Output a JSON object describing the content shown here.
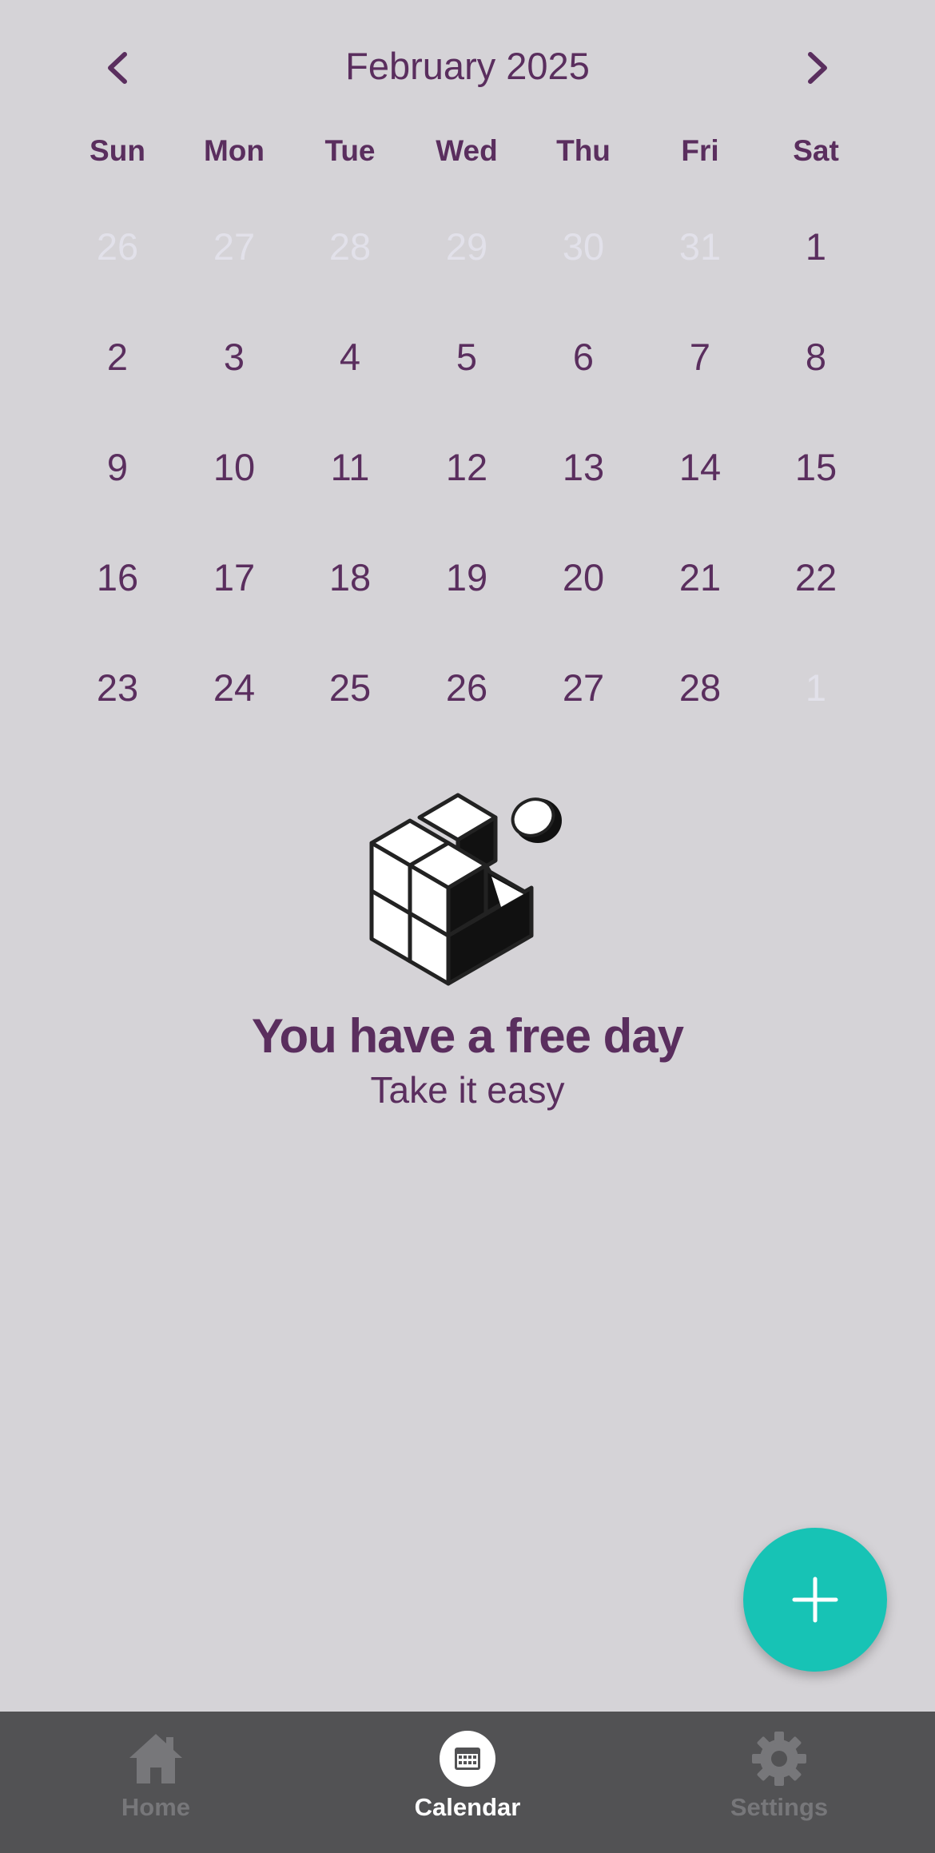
{
  "header": {
    "month_title": "February 2025"
  },
  "weekdays": [
    "Sun",
    "Mon",
    "Tue",
    "Wed",
    "Thu",
    "Fri",
    "Sat"
  ],
  "weeks": [
    [
      {
        "d": "26",
        "muted": true
      },
      {
        "d": "27",
        "muted": true
      },
      {
        "d": "28",
        "muted": true
      },
      {
        "d": "29",
        "muted": true
      },
      {
        "d": "30",
        "muted": true
      },
      {
        "d": "31",
        "muted": true
      },
      {
        "d": "1",
        "muted": false
      }
    ],
    [
      {
        "d": "2",
        "muted": false
      },
      {
        "d": "3",
        "muted": false
      },
      {
        "d": "4",
        "muted": false
      },
      {
        "d": "5",
        "muted": false
      },
      {
        "d": "6",
        "muted": false
      },
      {
        "d": "7",
        "muted": false
      },
      {
        "d": "8",
        "muted": false
      }
    ],
    [
      {
        "d": "9",
        "muted": false
      },
      {
        "d": "10",
        "muted": false
      },
      {
        "d": "11",
        "muted": false
      },
      {
        "d": "12",
        "muted": false
      },
      {
        "d": "13",
        "muted": false
      },
      {
        "d": "14",
        "muted": false
      },
      {
        "d": "15",
        "muted": false
      }
    ],
    [
      {
        "d": "16",
        "muted": false
      },
      {
        "d": "17",
        "muted": false
      },
      {
        "d": "18",
        "muted": false
      },
      {
        "d": "19",
        "muted": false
      },
      {
        "d": "20",
        "muted": false
      },
      {
        "d": "21",
        "muted": false
      },
      {
        "d": "22",
        "muted": false
      }
    ],
    [
      {
        "d": "23",
        "muted": false
      },
      {
        "d": "24",
        "muted": false
      },
      {
        "d": "25",
        "muted": false
      },
      {
        "d": "26",
        "muted": false
      },
      {
        "d": "27",
        "muted": false
      },
      {
        "d": "28",
        "muted": false
      },
      {
        "d": "1",
        "muted": true
      }
    ]
  ],
  "empty_state": {
    "title": "You have a free day",
    "subtitle": "Take it easy",
    "illustration_icon": "blocks-illustration-icon"
  },
  "fab": {
    "icon": "plus-icon"
  },
  "tabs": [
    {
      "label": "Home",
      "icon": "home-icon",
      "active": false
    },
    {
      "label": "Calendar",
      "icon": "calendar-icon",
      "active": true
    },
    {
      "label": "Settings",
      "icon": "gear-icon",
      "active": false
    }
  ],
  "colors": {
    "background": "#d5d3d7",
    "text": "#5a2e5e",
    "muted_day": "#e2e1ea",
    "fab": "#17c3b5",
    "tabbar": "#525254",
    "tab_inactive": "#77777a",
    "tab_active": "#ffffff"
  }
}
